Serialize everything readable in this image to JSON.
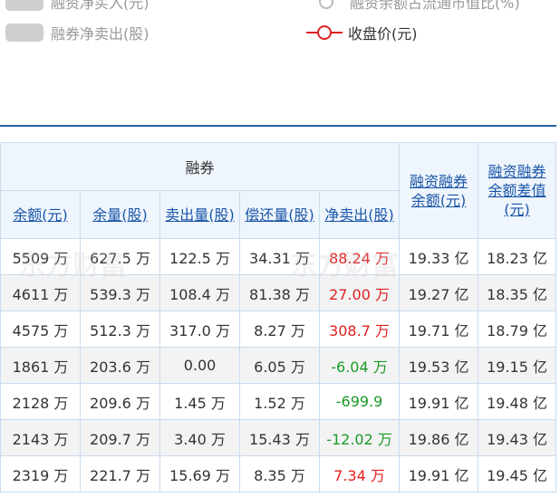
{
  "legend": {
    "item1_label": "融资净买入(元)",
    "item2_label": "融券净卖出(股)",
    "item3_label": "融资余额占流通市值比(%)",
    "item4_label": "收盘价(元)",
    "closing_color": "#e02020"
  },
  "table": {
    "group_header": "融券",
    "columns": {
      "balance_amount": "余额(元)",
      "balance_qty": "余量(股)",
      "sell_qty": "卖出量(股)",
      "repay_qty": "偿还量(股)",
      "net_sell": "净卖出(股)",
      "margin_balance_line1": "融资融券",
      "margin_balance_line2": "余额(元)",
      "margin_diff_line1": "融资融券",
      "margin_diff_line2": "余额差值",
      "margin_diff_line3": "(元)"
    },
    "rows": [
      [
        "5509 万",
        "627.5 万",
        "122.5 万",
        "34.31 万",
        "88.24 万",
        "19.33 亿",
        "18.23 亿"
      ],
      [
        "4611 万",
        "539.3 万",
        "108.4 万",
        "81.38 万",
        "27.00 万",
        "19.27 亿",
        "18.35 亿"
      ],
      [
        "4575 万",
        "512.3 万",
        "317.0 万",
        "8.27 万",
        "308.7 万",
        "19.71 亿",
        "18.79 亿"
      ],
      [
        "1861 万",
        "203.6 万",
        "0.00",
        "6.05 万",
        "-6.04 万",
        "19.53 亿",
        "19.15 亿"
      ],
      [
        "2128 万",
        "209.6 万",
        "1.45 万",
        "1.52 万",
        "-699.9",
        "19.91 亿",
        "19.48 亿"
      ],
      [
        "2143 万",
        "209.7 万",
        "3.40 万",
        "15.43 万",
        "-12.02 万",
        "19.86 亿",
        "19.43 亿"
      ],
      [
        "2319 万",
        "221.7 万",
        "15.69 万",
        "8.35 万",
        "7.34 万",
        "19.91 亿",
        "19.45 亿"
      ]
    ],
    "net_sell_colors": [
      "red",
      "red",
      "red",
      "green",
      "green",
      "green",
      "red"
    ]
  }
}
